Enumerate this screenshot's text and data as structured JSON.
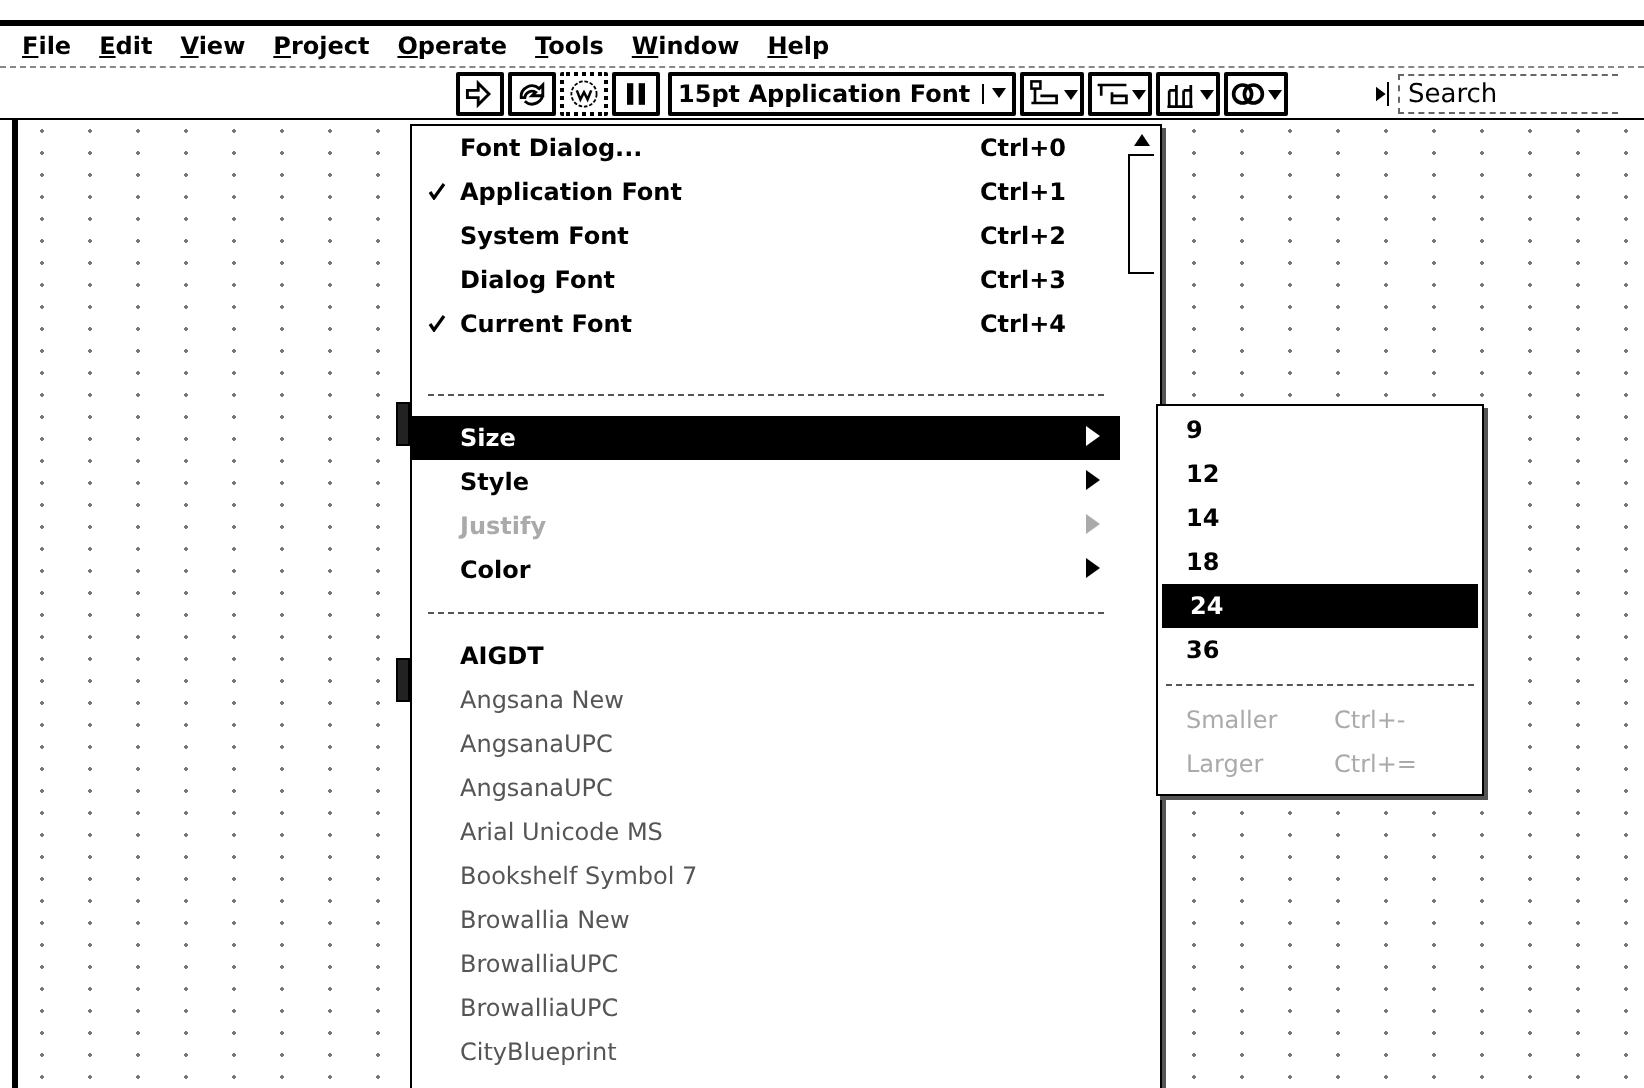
{
  "menubar": [
    {
      "label": "File"
    },
    {
      "label": "Edit"
    },
    {
      "label": "View"
    },
    {
      "label": "Project"
    },
    {
      "label": "Operate"
    },
    {
      "label": "Tools"
    },
    {
      "label": "Window"
    },
    {
      "label": "Help"
    }
  ],
  "toolbar": {
    "font_selector": "15pt Application Font",
    "search": {
      "placeholder": "Search"
    }
  },
  "font_menu": {
    "items": [
      {
        "kind": "item",
        "label": "Font Dialog...",
        "shortcut": "Ctrl+0",
        "checked": false,
        "disabled": false,
        "selected": false
      },
      {
        "kind": "item",
        "label": "Application Font",
        "shortcut": "Ctrl+1",
        "checked": true,
        "disabled": false,
        "selected": false
      },
      {
        "kind": "item",
        "label": "System Font",
        "shortcut": "Ctrl+2",
        "checked": false,
        "disabled": false,
        "selected": false
      },
      {
        "kind": "item",
        "label": "Dialog Font",
        "shortcut": "Ctrl+3",
        "checked": false,
        "disabled": false,
        "selected": false
      },
      {
        "kind": "item",
        "label": "Current Font",
        "shortcut": "Ctrl+4",
        "checked": true,
        "disabled": false,
        "selected": false
      },
      {
        "kind": "separator"
      },
      {
        "kind": "submenu",
        "label": "Size",
        "disabled": false,
        "selected": true
      },
      {
        "kind": "submenu",
        "label": "Style",
        "disabled": false,
        "selected": false
      },
      {
        "kind": "submenu",
        "label": "Justify",
        "disabled": true,
        "selected": false
      },
      {
        "kind": "submenu",
        "label": "Color",
        "disabled": false,
        "selected": false
      },
      {
        "kind": "separator"
      },
      {
        "kind": "font",
        "label": "AIGDT",
        "selected": false
      },
      {
        "kind": "font",
        "label": "Angsana New",
        "selected": false
      },
      {
        "kind": "font",
        "label": "AngsanaUPC",
        "selected": false
      },
      {
        "kind": "font",
        "label": "AngsanaUPC",
        "selected": false
      },
      {
        "kind": "font",
        "label": "Arial Unicode MS",
        "selected": false
      },
      {
        "kind": "font",
        "label": "Bookshelf Symbol 7",
        "selected": false
      },
      {
        "kind": "font",
        "label": "Browallia New",
        "selected": false
      },
      {
        "kind": "font",
        "label": "BrowalliaUPC",
        "selected": false
      },
      {
        "kind": "font",
        "label": "BrowalliaUPC",
        "selected": false
      },
      {
        "kind": "font",
        "label": "CityBlueprint",
        "selected": false
      }
    ]
  },
  "size_submenu": {
    "items": [
      {
        "kind": "size",
        "label": "9",
        "selected": false
      },
      {
        "kind": "size",
        "label": "12",
        "selected": false
      },
      {
        "kind": "size",
        "label": "14",
        "selected": false
      },
      {
        "kind": "size",
        "label": "18",
        "selected": false
      },
      {
        "kind": "size",
        "label": "24",
        "selected": true
      },
      {
        "kind": "size",
        "label": "36",
        "selected": false
      },
      {
        "kind": "separator"
      },
      {
        "kind": "action",
        "label": "Smaller",
        "shortcut": "Ctrl+-",
        "disabled": true,
        "selected": false
      },
      {
        "kind": "action",
        "label": "Larger",
        "shortcut": "Ctrl+=",
        "disabled": true,
        "selected": false
      }
    ]
  }
}
